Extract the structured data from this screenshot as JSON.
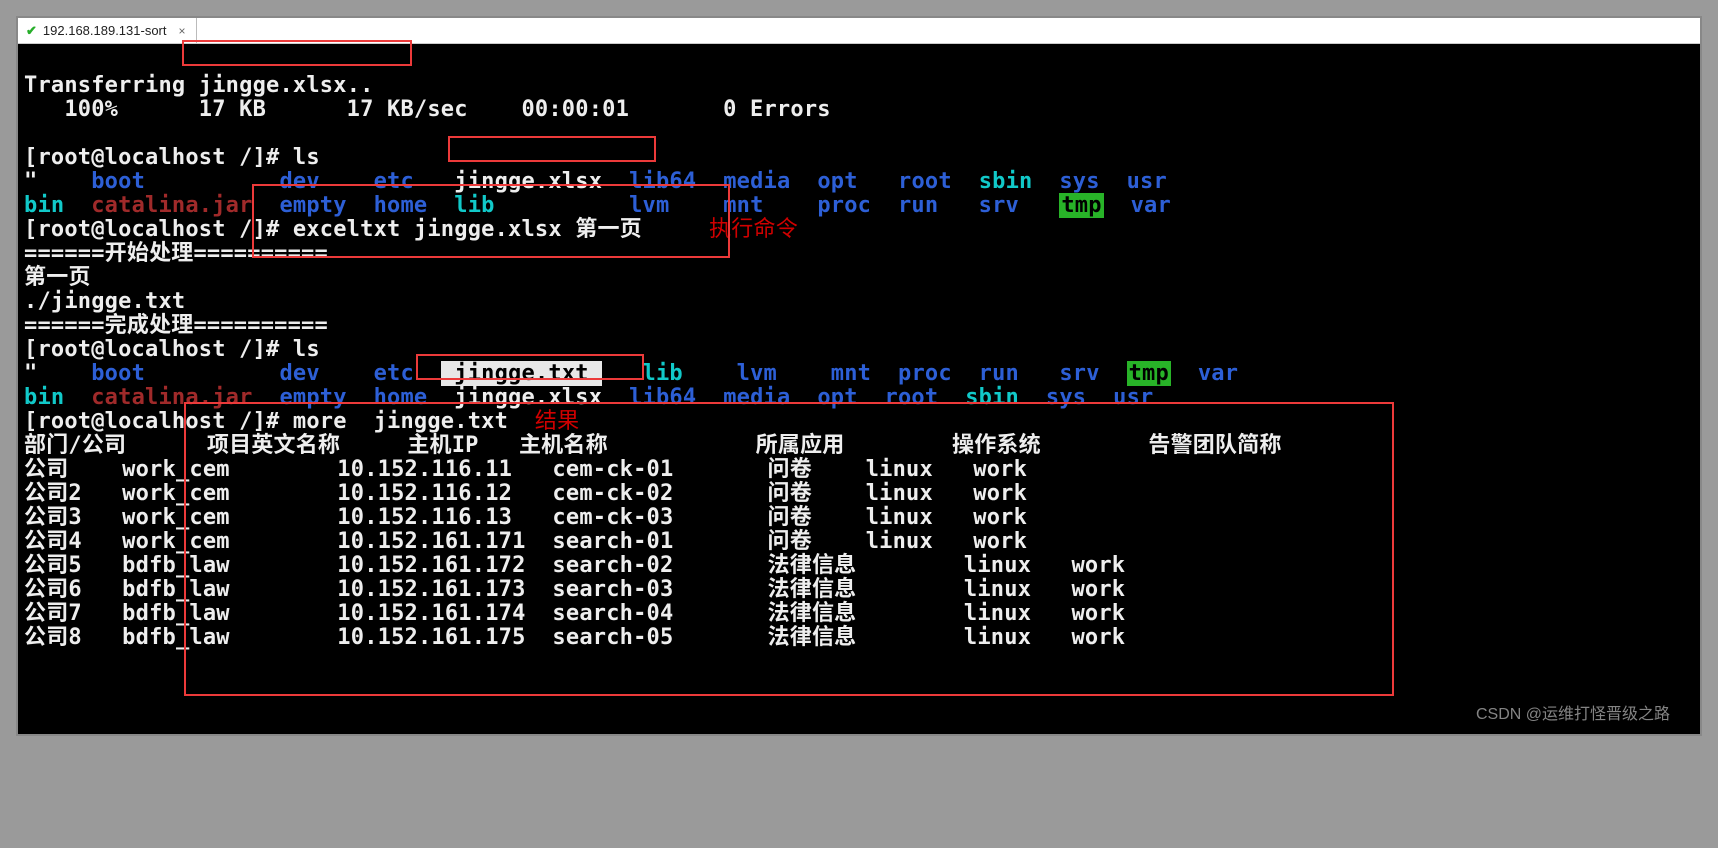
{
  "tab": {
    "title": "192.168.189.131-sort",
    "close": "×"
  },
  "transfer": {
    "line1_pre": "Transferring ",
    "line1_file": "jingge.xlsx..",
    "line2": "   100%      17 KB      17 KB/sec    00:00:01       0 Errors"
  },
  "prompts": {
    "ls1": "[root@localhost /]# ls",
    "cmd_pre": "[root@localhost /]",
    "cmd_body": "# exceltxt jingge.xlsx 第一页",
    "ls2": "[root@localhost /]# ls",
    "more": "[root@localhost /]# more  jingge.txt"
  },
  "proc": {
    "start": "======开始处理==========",
    "sheet": "第一页",
    "outfile": "./jingge.txt",
    "done": "======完成处理=========="
  },
  "ls1": {
    "r1": {
      "quote": "\"",
      "boot": "boot",
      "dev": "dev",
      "etc": "etc",
      "file": "jingge.xlsx",
      "lib64": "lib64",
      "media": "media",
      "opt": "opt",
      "root": "root",
      "sbin": "sbin",
      "sys": "sys",
      "usr": "usr"
    },
    "r2": {
      "bin": "bin",
      "jar": "catalina.jar",
      "empty": "empty",
      "home": "home",
      "lib": "lib",
      "lvm": "lvm",
      "mnt": "mnt",
      "proc": "proc",
      "run": "run",
      "srv": "srv",
      "tmp": "tmp",
      "var": "var"
    }
  },
  "ls2": {
    "r1": {
      "quote": "\"",
      "boot": "boot",
      "dev": "dev",
      "etc": "etc",
      "file_sel": " jingge.txt ",
      "lib": "lib",
      "lvm": "lvm",
      "mnt": "mnt",
      "proc": "proc",
      "run": "run",
      "srv": "srv",
      "tmp": "tmp",
      "var": "var"
    },
    "r2": {
      "bin": "bin",
      "jar": "catalina.jar",
      "empty": "empty",
      "home": "home",
      "xlsx": "jingge.xlsx",
      "lib64": "lib64",
      "media": "media",
      "opt": "opt",
      "root": "root",
      "sbin": "sbin",
      "sys": "sys",
      "usr": "usr"
    }
  },
  "annotations": {
    "exec": "执行命令",
    "result": "结果"
  },
  "table": {
    "header": "部门/公司      项目英文名称     主机IP   主机名称           所属应用        操作系统        告警团队简称",
    "rows": [
      "公司    work_cem        10.152.116.11   cem-ck-01       问卷    linux   work",
      "公司2   work_cem        10.152.116.12   cem-ck-02       问卷    linux   work",
      "公司3   work_cem        10.152.116.13   cem-ck-03       问卷    linux   work",
      "公司4   work_cem        10.152.161.171  search-01       问卷    linux   work",
      "公司5   bdfb_law        10.152.161.172  search-02       法律信息        linux   work",
      "公司6   bdfb_law        10.152.161.173  search-03       法律信息        linux   work",
      "公司7   bdfb_law        10.152.161.174  search-04       法律信息        linux   work",
      "公司8   bdfb_law        10.152.161.175  search-05       法律信息        linux   work"
    ]
  },
  "watermark": "CSDN @运维打怪晋级之路"
}
